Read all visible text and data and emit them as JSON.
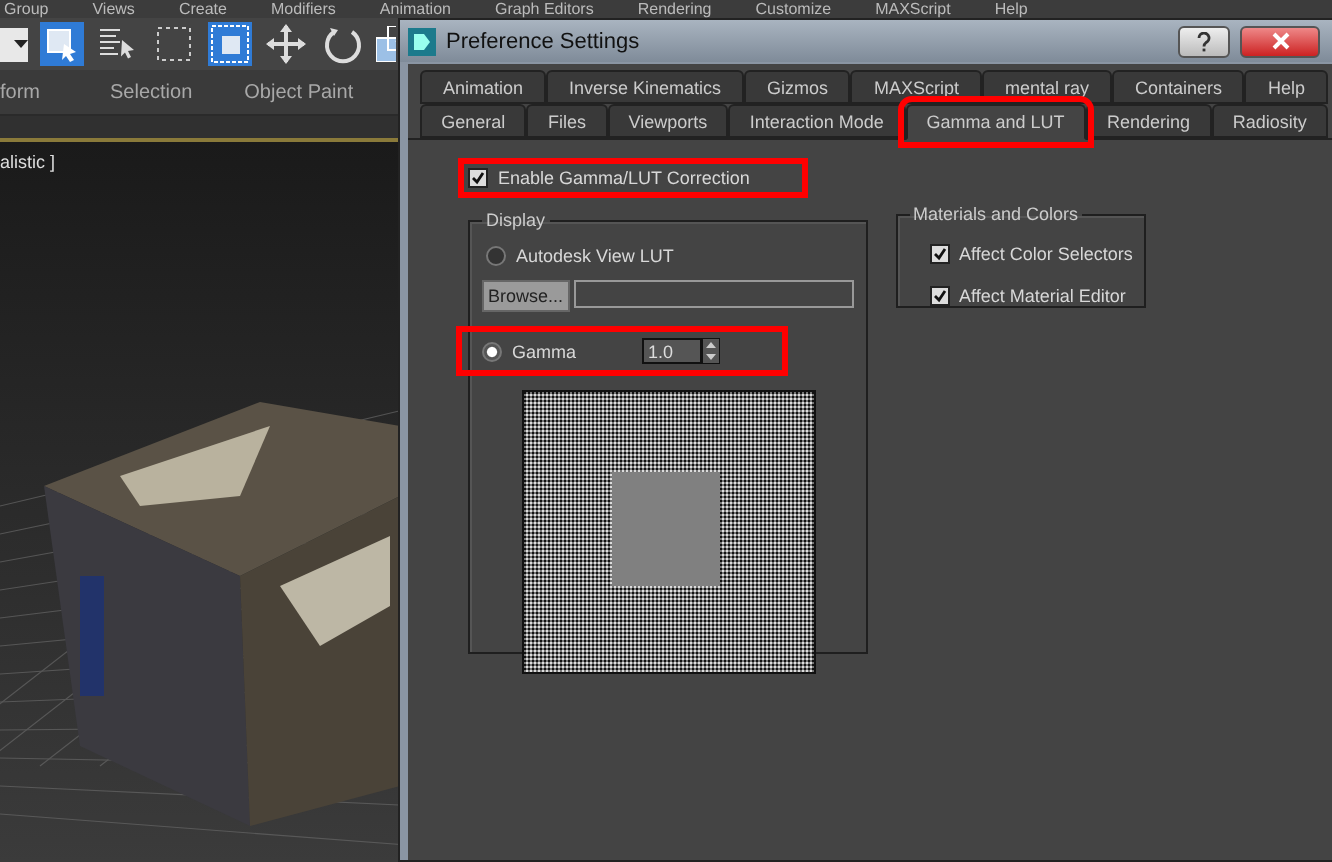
{
  "menu_bar": [
    "Group",
    "Views",
    "Create",
    "Modifiers",
    "Animation",
    "Graph Editors",
    "Rendering",
    "Customize",
    "MAXScript",
    "Help"
  ],
  "ribbon_tabs": [
    "form",
    "Selection",
    "Object Paint"
  ],
  "viewport": {
    "label": "alistic ]"
  },
  "dialog": {
    "title": "Preference Settings",
    "tab_rows": [
      [
        {
          "label": "Animation",
          "selected": false,
          "highlighted": false
        },
        {
          "label": "Inverse Kinematics",
          "selected": false,
          "highlighted": false
        },
        {
          "label": "Gizmos",
          "selected": false,
          "highlighted": false
        },
        {
          "label": "MAXScript",
          "selected": false,
          "highlighted": false
        },
        {
          "label": "mental ray",
          "selected": false,
          "highlighted": false
        },
        {
          "label": "Containers",
          "selected": false,
          "highlighted": false
        },
        {
          "label": "Help",
          "selected": false,
          "highlighted": false
        }
      ],
      [
        {
          "label": "General",
          "selected": false,
          "highlighted": false
        },
        {
          "label": "Files",
          "selected": false,
          "highlighted": false
        },
        {
          "label": "Viewports",
          "selected": false,
          "highlighted": false
        },
        {
          "label": "Interaction Mode",
          "selected": false,
          "highlighted": false
        },
        {
          "label": "Gamma and LUT",
          "selected": true,
          "highlighted": true
        },
        {
          "label": "Rendering",
          "selected": false,
          "highlighted": false
        },
        {
          "label": "Radiosity",
          "selected": false,
          "highlighted": false
        }
      ]
    ],
    "enable": {
      "label": "Enable Gamma/LUT Correction",
      "checked": true,
      "highlighted": true
    },
    "display": {
      "title": "Display",
      "lut": {
        "label": "Autodesk View LUT",
        "selected": false
      },
      "browse_button": "Browse...",
      "gamma": {
        "label": "Gamma",
        "selected": true,
        "highlighted": true,
        "value": "1.0"
      }
    },
    "materials": {
      "title": "Materials and Colors",
      "items": [
        {
          "label": "Affect Color Selectors",
          "checked": true
        },
        {
          "label": "Affect Material Editor",
          "checked": true
        }
      ]
    }
  }
}
